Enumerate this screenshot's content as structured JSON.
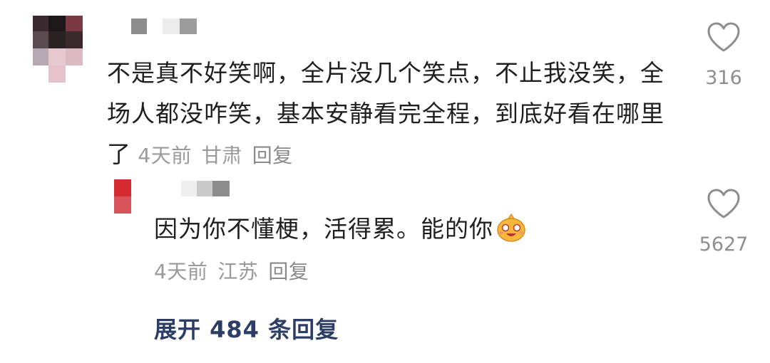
{
  "comment": {
    "text": "不是真不好笑啊，全片没几个笑点，不止我没笑，全场人都没咋笑，基本安静看完全程，到底好看在哪里了",
    "time": "4天前",
    "location": "甘肃",
    "reply_label": "回复",
    "like_count": "316"
  },
  "reply": {
    "text": "因为你不懂梗，活得累。能的你",
    "emoji": "laughing-crying-emoji",
    "time": "4天前",
    "location": "江苏",
    "reply_label": "回复",
    "like_count": "5627"
  },
  "expand_label": "展开 484 条回复",
  "colors": {
    "text": "#1f1f1f",
    "meta": "#9a9a9a",
    "expand": "#2c3d66",
    "heart_outline": "#8e8e8e"
  }
}
